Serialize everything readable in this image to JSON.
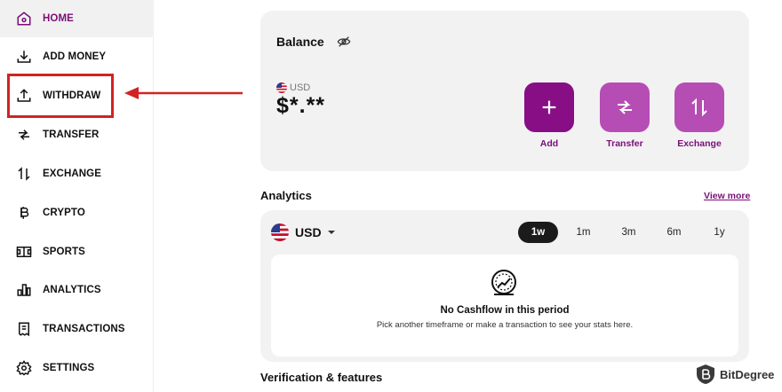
{
  "sidebar": {
    "items": [
      {
        "label": "HOME",
        "icon": "home-icon"
      },
      {
        "label": "ADD MONEY",
        "icon": "download-icon"
      },
      {
        "label": "WITHDRAW",
        "icon": "upload-icon"
      },
      {
        "label": "TRANSFER",
        "icon": "transfer-icon"
      },
      {
        "label": "EXCHANGE",
        "icon": "exchange-icon"
      },
      {
        "label": "CRYPTO",
        "icon": "bitcoin-icon"
      },
      {
        "label": "SPORTS",
        "icon": "field-icon"
      },
      {
        "label": "ANALYTICS",
        "icon": "bar-chart-icon"
      },
      {
        "label": "TRANSACTIONS",
        "icon": "receipt-icon"
      },
      {
        "label": "SETTINGS",
        "icon": "gear-icon"
      }
    ],
    "active_index": 0
  },
  "balance": {
    "title": "Balance",
    "currency": "USD",
    "amount": "$*.**",
    "actions": [
      {
        "label": "Add",
        "icon": "plus-icon"
      },
      {
        "label": "Transfer",
        "icon": "transfer-icon"
      },
      {
        "label": "Exchange",
        "icon": "exchange-icon"
      }
    ]
  },
  "analytics": {
    "title": "Analytics",
    "view_more": "View more",
    "currency": "USD",
    "periods": [
      "1w",
      "1m",
      "3m",
      "6m",
      "1y"
    ],
    "active_period": "1w",
    "empty_title": "No Cashflow in this period",
    "empty_subtitle": "Pick another timeframe or make a transaction to see your stats here."
  },
  "verification": {
    "title": "Verification & features"
  },
  "watermark": {
    "brand": "BitDegree"
  },
  "colors": {
    "accent": "#7a0e78",
    "primary_button": "#870e85",
    "secondary_button": "#b64db4",
    "highlight": "#d32222"
  }
}
